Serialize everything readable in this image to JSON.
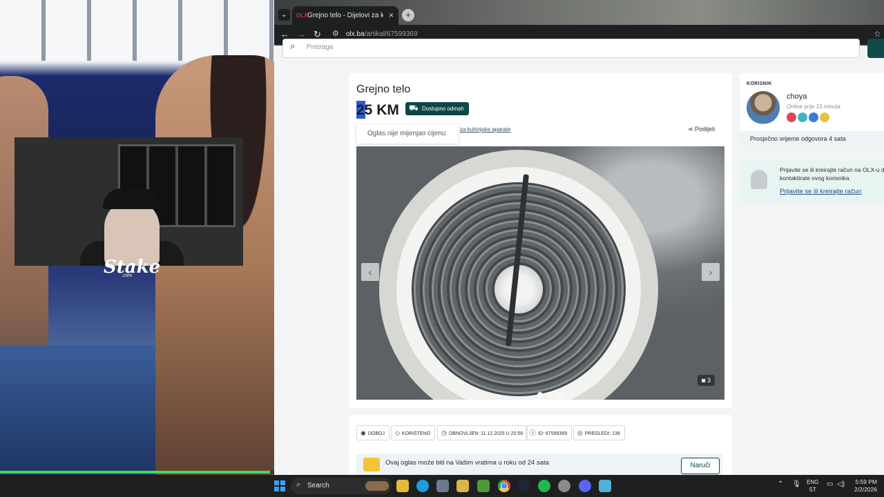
{
  "browser": {
    "tab_title": "Grejno telo - Dijelovi za kuhinjske",
    "tab_favicon": "OLX",
    "tab_close": "×",
    "new_tab": "+",
    "url_domain": "olx.ba",
    "url_path": "/artikal/67599369"
  },
  "page": {
    "search_placeholder": "Pretraga",
    "ad": {
      "title": "Grejno telo",
      "price_selected": "2",
      "price": "25 KM",
      "availability": "Dostupno odmah",
      "tooltip": "Oglas nije mijenjao cijenu",
      "category_link": "za kuhinjske aparate",
      "share": "Podijeli",
      "photo_count": "3",
      "photo_dots": 3,
      "active_photo": 1
    },
    "meta_chips": [
      {
        "icon": "location-icon",
        "label": "DOBOJ"
      },
      {
        "icon": "tag-icon",
        "label": "KORIŠTENO"
      },
      {
        "icon": "clock-icon",
        "label": "OBNOVLJEN: 11.12.2025 U 20:58"
      },
      {
        "icon": "id-icon",
        "label": "ID: 67599369"
      },
      {
        "icon": "eye-icon",
        "label": "PREGLEDI: 139"
      }
    ],
    "delivery": {
      "text": "Ovaj oglas može biti na Vašim vratima u roku od 24 sata",
      "button": "Naruči"
    },
    "user": {
      "section_label": "KORISNIK",
      "name": "choya",
      "online": "Online prije 13 minuta",
      "response_time": "Prosječno vrijeme odgovora 4 sata",
      "badge_colors": [
        "#e0455a",
        "#3bb7c4",
        "#3a7bd5",
        "#e9c23b"
      ]
    },
    "login": {
      "text": "Prijavite se ili kreirajte račun na OLX-u da kontaktirate ovog korisnika.",
      "link": "Prijavite se ili kreirajte račun"
    }
  },
  "stream": {
    "overlay_brand": "Stake",
    "overlay_brand_sub": ".com",
    "progress": 0.985
  },
  "taskbar": {
    "search_label": "Search",
    "lang_top": "ENG",
    "lang_bottom": "ST",
    "time": "5:59 PM",
    "date": "2/2/2026",
    "icons": [
      "file-explorer-icon",
      "edge-icon",
      "store-icon",
      "notes-icon",
      "minecraft-icon",
      "chrome-icon",
      "steam-icon",
      "spotify-icon",
      "github-icon",
      "discord-icon",
      "notepad-icon"
    ]
  },
  "colors": {
    "olx_dark_teal": "#0e4747",
    "selection_blue": "#2a5bd7",
    "progress_green": "#48d858"
  }
}
